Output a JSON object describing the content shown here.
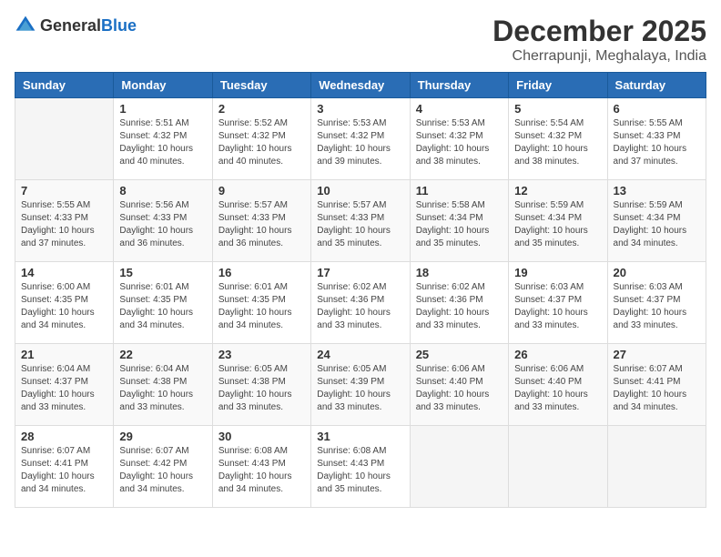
{
  "logo": {
    "general": "General",
    "blue": "Blue"
  },
  "title": {
    "month": "December 2025",
    "location": "Cherrapunji, Meghalaya, India"
  },
  "headers": [
    "Sunday",
    "Monday",
    "Tuesday",
    "Wednesday",
    "Thursday",
    "Friday",
    "Saturday"
  ],
  "weeks": [
    [
      {
        "day": "",
        "info": ""
      },
      {
        "day": "1",
        "info": "Sunrise: 5:51 AM\nSunset: 4:32 PM\nDaylight: 10 hours\nand 40 minutes."
      },
      {
        "day": "2",
        "info": "Sunrise: 5:52 AM\nSunset: 4:32 PM\nDaylight: 10 hours\nand 40 minutes."
      },
      {
        "day": "3",
        "info": "Sunrise: 5:53 AM\nSunset: 4:32 PM\nDaylight: 10 hours\nand 39 minutes."
      },
      {
        "day": "4",
        "info": "Sunrise: 5:53 AM\nSunset: 4:32 PM\nDaylight: 10 hours\nand 38 minutes."
      },
      {
        "day": "5",
        "info": "Sunrise: 5:54 AM\nSunset: 4:32 PM\nDaylight: 10 hours\nand 38 minutes."
      },
      {
        "day": "6",
        "info": "Sunrise: 5:55 AM\nSunset: 4:33 PM\nDaylight: 10 hours\nand 37 minutes."
      }
    ],
    [
      {
        "day": "7",
        "info": "Sunrise: 5:55 AM\nSunset: 4:33 PM\nDaylight: 10 hours\nand 37 minutes."
      },
      {
        "day": "8",
        "info": "Sunrise: 5:56 AM\nSunset: 4:33 PM\nDaylight: 10 hours\nand 36 minutes."
      },
      {
        "day": "9",
        "info": "Sunrise: 5:57 AM\nSunset: 4:33 PM\nDaylight: 10 hours\nand 36 minutes."
      },
      {
        "day": "10",
        "info": "Sunrise: 5:57 AM\nSunset: 4:33 PM\nDaylight: 10 hours\nand 35 minutes."
      },
      {
        "day": "11",
        "info": "Sunrise: 5:58 AM\nSunset: 4:34 PM\nDaylight: 10 hours\nand 35 minutes."
      },
      {
        "day": "12",
        "info": "Sunrise: 5:59 AM\nSunset: 4:34 PM\nDaylight: 10 hours\nand 35 minutes."
      },
      {
        "day": "13",
        "info": "Sunrise: 5:59 AM\nSunset: 4:34 PM\nDaylight: 10 hours\nand 34 minutes."
      }
    ],
    [
      {
        "day": "14",
        "info": "Sunrise: 6:00 AM\nSunset: 4:35 PM\nDaylight: 10 hours\nand 34 minutes."
      },
      {
        "day": "15",
        "info": "Sunrise: 6:01 AM\nSunset: 4:35 PM\nDaylight: 10 hours\nand 34 minutes."
      },
      {
        "day": "16",
        "info": "Sunrise: 6:01 AM\nSunset: 4:35 PM\nDaylight: 10 hours\nand 34 minutes."
      },
      {
        "day": "17",
        "info": "Sunrise: 6:02 AM\nSunset: 4:36 PM\nDaylight: 10 hours\nand 33 minutes."
      },
      {
        "day": "18",
        "info": "Sunrise: 6:02 AM\nSunset: 4:36 PM\nDaylight: 10 hours\nand 33 minutes."
      },
      {
        "day": "19",
        "info": "Sunrise: 6:03 AM\nSunset: 4:37 PM\nDaylight: 10 hours\nand 33 minutes."
      },
      {
        "day": "20",
        "info": "Sunrise: 6:03 AM\nSunset: 4:37 PM\nDaylight: 10 hours\nand 33 minutes."
      }
    ],
    [
      {
        "day": "21",
        "info": "Sunrise: 6:04 AM\nSunset: 4:37 PM\nDaylight: 10 hours\nand 33 minutes."
      },
      {
        "day": "22",
        "info": "Sunrise: 6:04 AM\nSunset: 4:38 PM\nDaylight: 10 hours\nand 33 minutes."
      },
      {
        "day": "23",
        "info": "Sunrise: 6:05 AM\nSunset: 4:38 PM\nDaylight: 10 hours\nand 33 minutes."
      },
      {
        "day": "24",
        "info": "Sunrise: 6:05 AM\nSunset: 4:39 PM\nDaylight: 10 hours\nand 33 minutes."
      },
      {
        "day": "25",
        "info": "Sunrise: 6:06 AM\nSunset: 4:40 PM\nDaylight: 10 hours\nand 33 minutes."
      },
      {
        "day": "26",
        "info": "Sunrise: 6:06 AM\nSunset: 4:40 PM\nDaylight: 10 hours\nand 33 minutes."
      },
      {
        "day": "27",
        "info": "Sunrise: 6:07 AM\nSunset: 4:41 PM\nDaylight: 10 hours\nand 34 minutes."
      }
    ],
    [
      {
        "day": "28",
        "info": "Sunrise: 6:07 AM\nSunset: 4:41 PM\nDaylight: 10 hours\nand 34 minutes."
      },
      {
        "day": "29",
        "info": "Sunrise: 6:07 AM\nSunset: 4:42 PM\nDaylight: 10 hours\nand 34 minutes."
      },
      {
        "day": "30",
        "info": "Sunrise: 6:08 AM\nSunset: 4:43 PM\nDaylight: 10 hours\nand 34 minutes."
      },
      {
        "day": "31",
        "info": "Sunrise: 6:08 AM\nSunset: 4:43 PM\nDaylight: 10 hours\nand 35 minutes."
      },
      {
        "day": "",
        "info": ""
      },
      {
        "day": "",
        "info": ""
      },
      {
        "day": "",
        "info": ""
      }
    ]
  ]
}
